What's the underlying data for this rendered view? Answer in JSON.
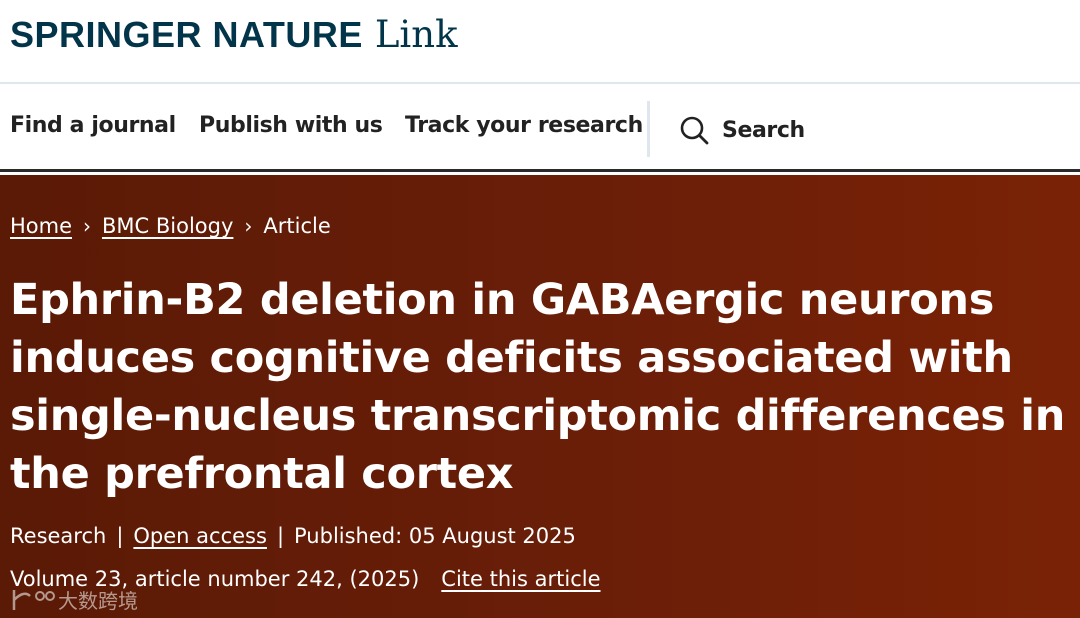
{
  "header": {
    "logo_brand": "SPRINGER NATURE",
    "logo_link": "Link"
  },
  "nav": {
    "items": [
      {
        "label": "Find a journal"
      },
      {
        "label": "Publish with us"
      },
      {
        "label": "Track your research"
      }
    ],
    "search_label": "Search"
  },
  "breadcrumb": {
    "home": "Home",
    "journal": "BMC Biology",
    "current": "Article",
    "separator": "›"
  },
  "article": {
    "title": "Ephrin-B2 deletion in GABAergic neurons induces cognitive deficits associated with single-nucleus transcriptomic differences in the prefrontal cortex",
    "type": "Research",
    "access": "Open access",
    "published": "Published: 05 August 2025",
    "volume_info": "Volume 23, article number 242, (2025)",
    "cite_label": "Cite this article",
    "separator": "|"
  },
  "watermark": {
    "text": "大数跨境"
  },
  "colors": {
    "brand": "#02344a",
    "hero_bg": "#6a1e08",
    "nav_text": "#222222"
  }
}
